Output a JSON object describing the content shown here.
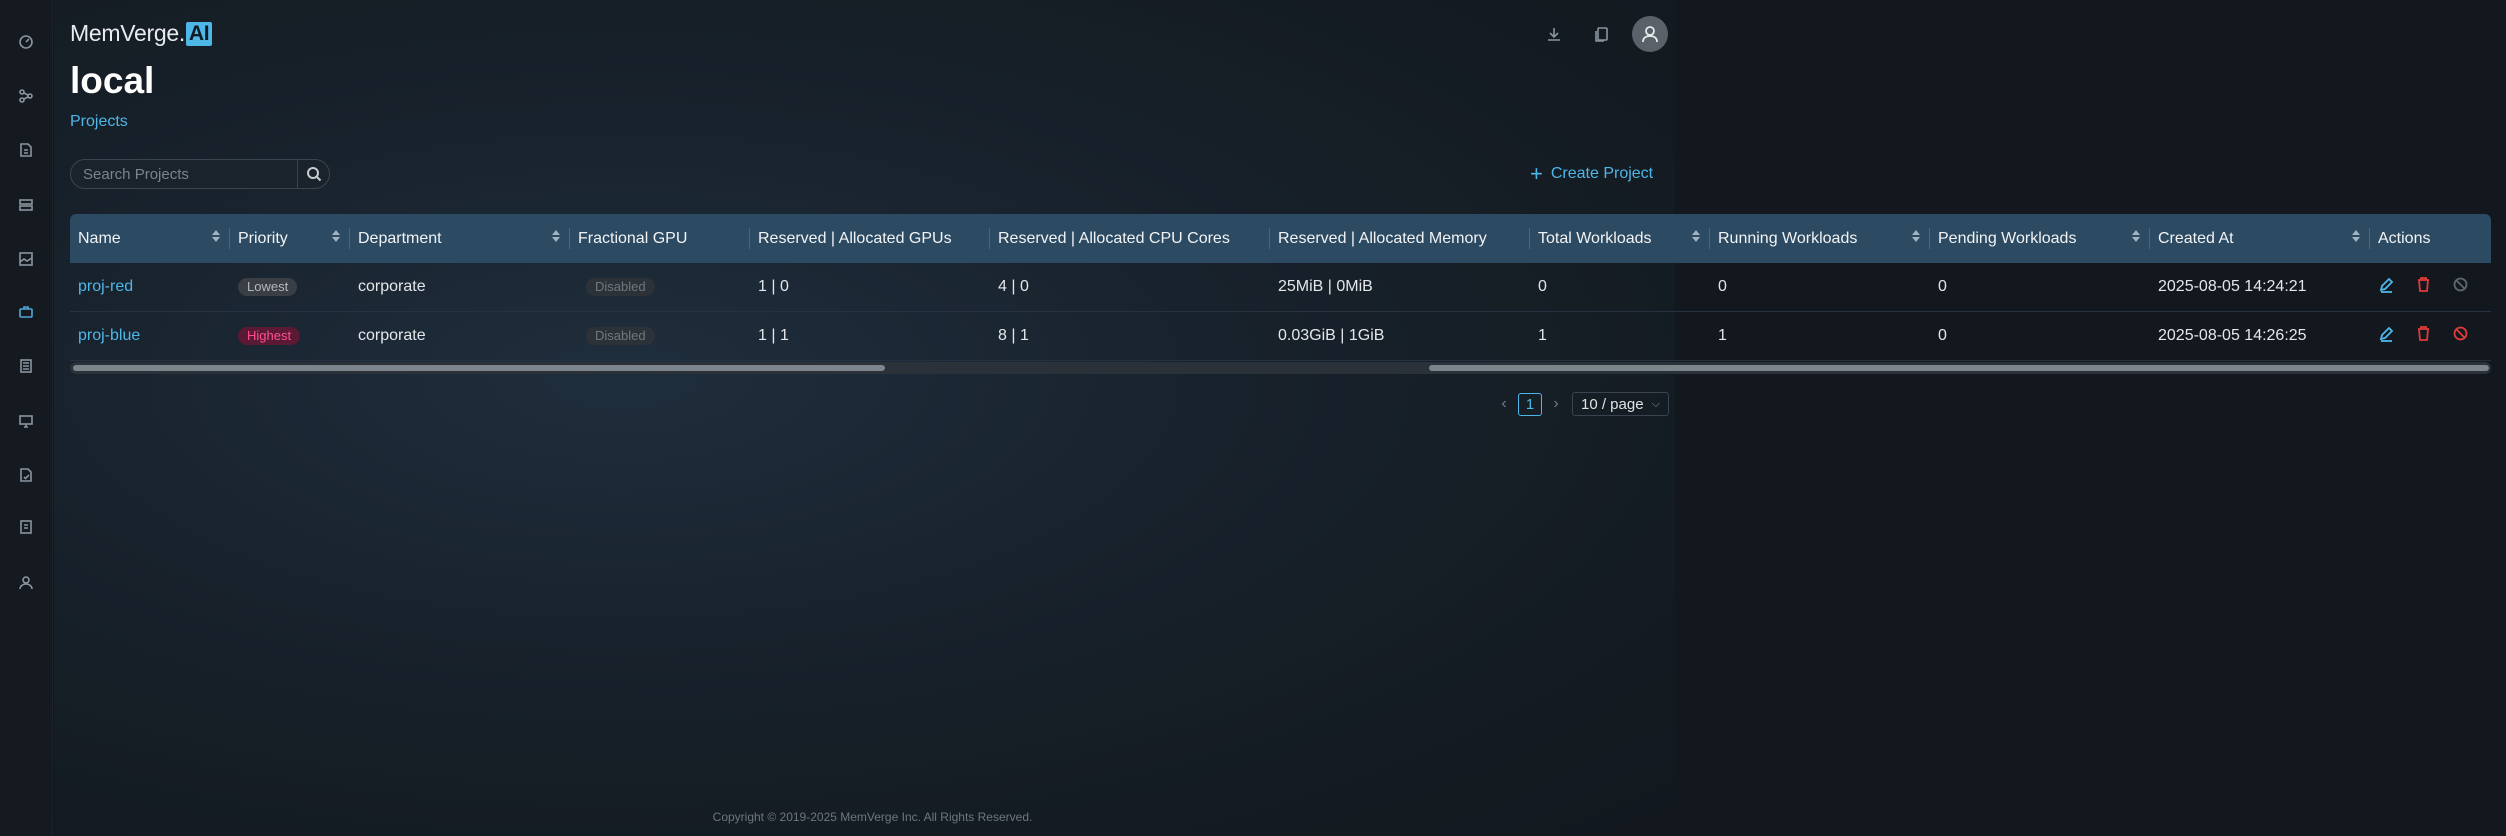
{
  "brand": {
    "name": "MemVerge.",
    "ai": "AI"
  },
  "page": {
    "title": "local",
    "breadcrumb": "Projects"
  },
  "search": {
    "placeholder": "Search Projects",
    "value": ""
  },
  "actions": {
    "create_label": "Create Project"
  },
  "sidebar": {
    "icons": [
      "dashboard-icon",
      "cluster-icon",
      "document-icon",
      "server-icon",
      "image-icon",
      "projects-icon",
      "list-icon",
      "monitor-icon",
      "report-icon",
      "book-icon",
      "user-icon"
    ],
    "active": "projects-icon"
  },
  "table": {
    "columns": [
      {
        "label": "Name",
        "sortable": true
      },
      {
        "label": "Priority",
        "sortable": true
      },
      {
        "label": "Department",
        "sortable": true
      },
      {
        "label": "Fractional GPU",
        "sortable": false
      },
      {
        "label": "Reserved | Allocated GPUs",
        "sortable": false
      },
      {
        "label": "Reserved | Allocated CPU Cores",
        "sortable": false
      },
      {
        "label": "Reserved | Allocated Memory",
        "sortable": false
      },
      {
        "label": "Total Workloads",
        "sortable": true
      },
      {
        "label": "Running Workloads",
        "sortable": true
      },
      {
        "label": "Pending Workloads",
        "sortable": true
      },
      {
        "label": "Created At",
        "sortable": true
      },
      {
        "label": "Actions",
        "sortable": false
      }
    ],
    "rows": [
      {
        "name": "proj-red",
        "priority": "Lowest",
        "department": "corporate",
        "fractional_gpu": "Disabled",
        "gpus": "1 | 0",
        "cpu": "4 | 0",
        "memory": "25MiB | 0MiB",
        "total": "0",
        "running": "0",
        "pending": "0",
        "created": "2025-08-05 14:24:21",
        "disable_active": false
      },
      {
        "name": "proj-blue",
        "priority": "Highest",
        "department": "corporate",
        "fractional_gpu": "Disabled",
        "gpus": "1 | 1",
        "cpu": "8 | 1",
        "memory": "0.03GiB | 1GiB",
        "total": "1",
        "running": "1",
        "pending": "0",
        "created": "2025-08-05 14:26:25",
        "disable_active": true
      }
    ]
  },
  "pagination": {
    "current": "1",
    "page_size": "10 / page"
  },
  "footer": {
    "copyright": "Copyright © 2019-2025 MemVerge Inc. All Rights Reserved."
  },
  "colors": {
    "accent": "#4fb6e8",
    "danger": "#e03a3a",
    "header_bg": "#2c4a61"
  }
}
